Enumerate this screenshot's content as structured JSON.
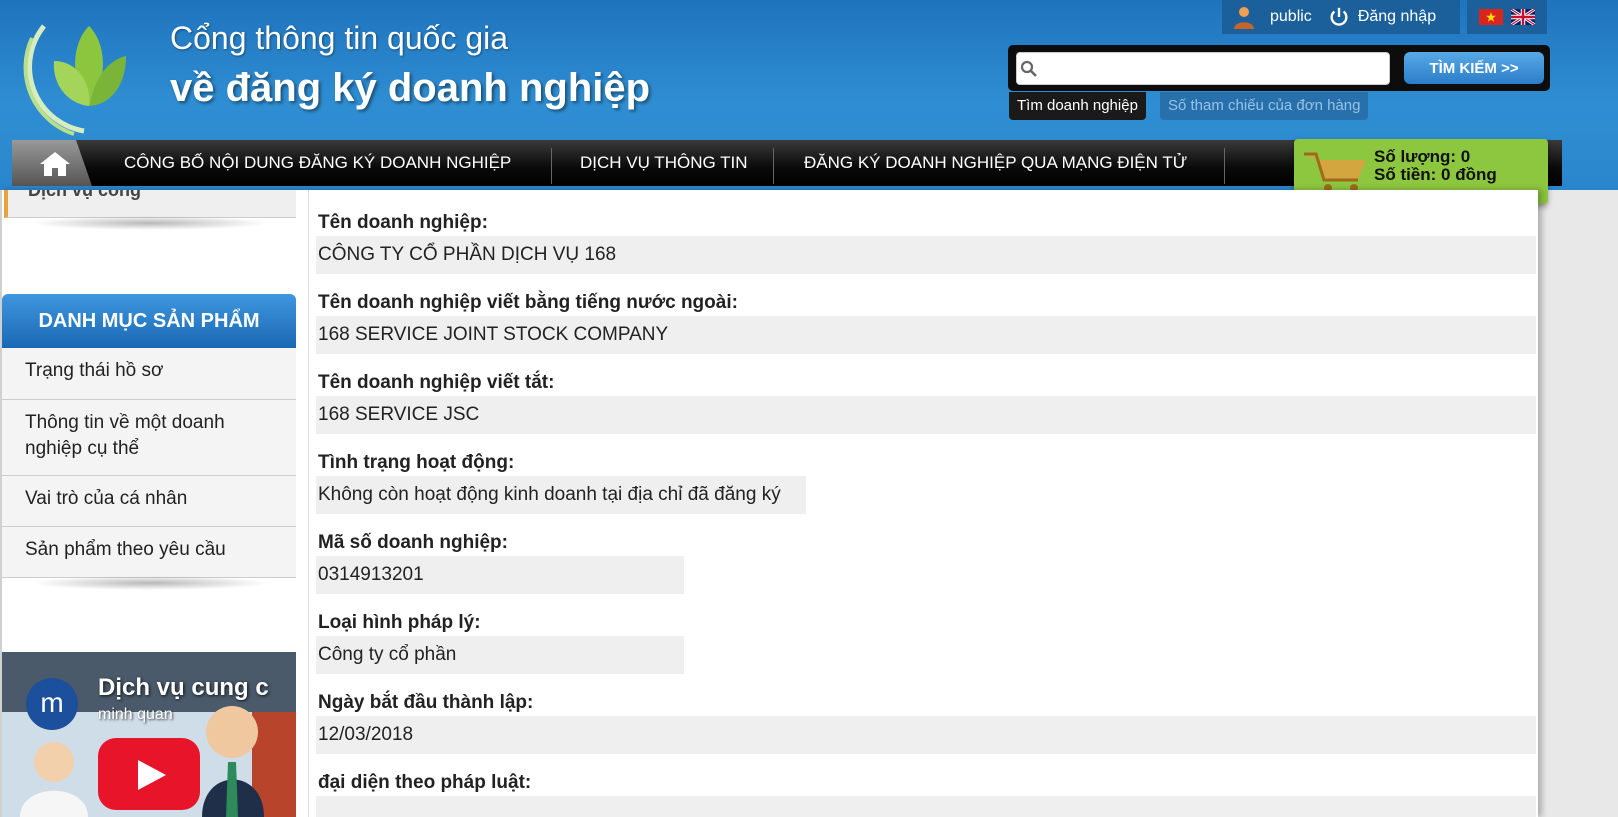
{
  "header": {
    "title_line1": "Cổng thông tin quốc gia",
    "title_line2": "về đăng ký doanh nghiệp",
    "user_label": "public",
    "login_label": "Đăng nhập"
  },
  "search": {
    "value": "",
    "button_label": "TÌM KIẾM >>",
    "tab_business": "Tìm doanh nghiệp",
    "tab_order": "Số tham chiếu của đơn hàng"
  },
  "nav": {
    "items": [
      "CÔNG BỐ NỘI DUNG ĐĂNG KÝ DOANH NGHIỆP",
      "DỊCH VỤ THÔNG TIN",
      "ĐĂNG KÝ DOANH NGHIỆP QUA MẠNG ĐIỆN TỬ"
    ]
  },
  "cart": {
    "quantity": "Số lượng: 0",
    "amount": "Số tiền: 0 đồng"
  },
  "sidebar": {
    "top_item": "Dịch vụ công",
    "heading": "DANH MỤC SẢN PHẨM",
    "items": [
      "Trạng thái hồ sơ",
      "Thông tin về một doanh nghiệp cụ thể",
      "Vai trò của cá nhân",
      "Sản phẩm theo yêu cầu"
    ]
  },
  "video": {
    "title": "Dịch vụ cung c",
    "channel": "minh quan",
    "avatar_letter": "m"
  },
  "details": {
    "fields": [
      {
        "label": "Tên doanh nghiệp:",
        "value": "CÔNG TY CỔ PHẦN DỊCH VỤ 168"
      },
      {
        "label": "Tên doanh nghiệp viết bằng tiếng nước ngoài:",
        "value": "168 SERVICE JOINT STOCK COMPANY"
      },
      {
        "label": "Tên doanh nghiệp viết tắt:",
        "value": "168 SERVICE JSC"
      },
      {
        "label": "Tình trạng hoạt động:",
        "value": "Không còn hoạt động kinh doanh tại địa chỉ đã đăng ký"
      },
      {
        "label": "Mã số doanh nghiệp:",
        "value": "0314913201"
      },
      {
        "label": "Loại hình pháp lý:",
        "value": "Công ty cổ phần"
      },
      {
        "label": "Ngày bắt đầu thành lập:",
        "value": "12/03/2018"
      },
      {
        "label": "đại diện theo pháp luật:",
        "value": ""
      }
    ]
  },
  "colors": {
    "header_blue": "#2a86cc",
    "cart_green": "#8dc63f",
    "sidebar_heading_blue": "#1a68b4",
    "accent_orange": "#e8a33a"
  },
  "icons": [
    "logo-icon",
    "user-icon",
    "power-icon",
    "vietnam-flag-icon",
    "uk-flag-icon",
    "search-icon",
    "home-icon",
    "cart-icon",
    "youtube-play-icon"
  ]
}
